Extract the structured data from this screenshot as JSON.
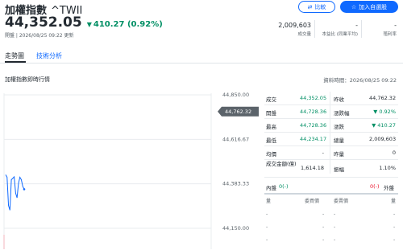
{
  "header": {
    "name": "加權指數",
    "symbol": "^TWII",
    "price": "44,352.05",
    "change": "410.27 (0.92%)",
    "timeline": "開盤 | 2026/08/25 09:22 更新",
    "compare_label": "比較",
    "watch_label": "加入自選股"
  },
  "stats": [
    {
      "value": "2,009,603",
      "label": "成交量"
    },
    {
      "value": "-",
      "label": "本益比 (同業平均)"
    },
    {
      "value": "-",
      "label": "殖利率"
    }
  ],
  "tabs": [
    {
      "label": "走勢圖",
      "active": true
    },
    {
      "label": "技術分析",
      "active": false
    }
  ],
  "section": {
    "title": "加權指數即時行情",
    "time": "資料時間：2026/08/25 09:22"
  },
  "chart_data": {
    "type": "line",
    "y_ticks": [
      "44,850.00",
      "44,616.67",
      "44,383.33",
      "44,150.00"
    ],
    "ylim": [
      44150,
      44850
    ],
    "current_label": "44,762.32",
    "current_value": 44762.32,
    "series_values": [
      44431,
      44418,
      44270,
      44245,
      44405,
      44412,
      44420,
      44335,
      44310,
      44385,
      44418,
      44405,
      44370,
      44355
    ],
    "accent_color": "#0f69ff",
    "grid": true
  },
  "quote_table": [
    {
      "l1": "成交",
      "v1": "44,352.05",
      "l2": "昨收",
      "v2": "44,762.32",
      "c1": "green",
      "c2": "dark"
    },
    {
      "l1": "開盤",
      "v1": "44,728.36",
      "l2": "漲跌幅",
      "v2": "▼ 0.92%",
      "c1": "green",
      "c2": "green"
    },
    {
      "l1": "最高",
      "v1": "44,728.36",
      "l2": "漲跌",
      "v2": "▼ 410.27",
      "c1": "green",
      "c2": "green"
    },
    {
      "l1": "最低",
      "v1": "44,234.17",
      "l2": "總量",
      "v2": "2,009,603",
      "c1": "green",
      "c2": "dark"
    },
    {
      "l1": "均價",
      "v1": "-",
      "l2": "昨量",
      "v2": "0",
      "c1": "dark",
      "c2": "dark"
    },
    {
      "l1": "成交金額(億)",
      "v1": "1,614.18",
      "l2": "振幅",
      "v2": "1.10%",
      "c1": "dark",
      "c2": "dark"
    }
  ],
  "bid_ask": {
    "inner_label": "內盤",
    "inner_value": "0(-)",
    "outer_label": "外盤",
    "outer_value": "0(-)",
    "qty_label": "量",
    "bid_label": "委買價",
    "ask_label": "委賣價",
    "dash": "-"
  }
}
